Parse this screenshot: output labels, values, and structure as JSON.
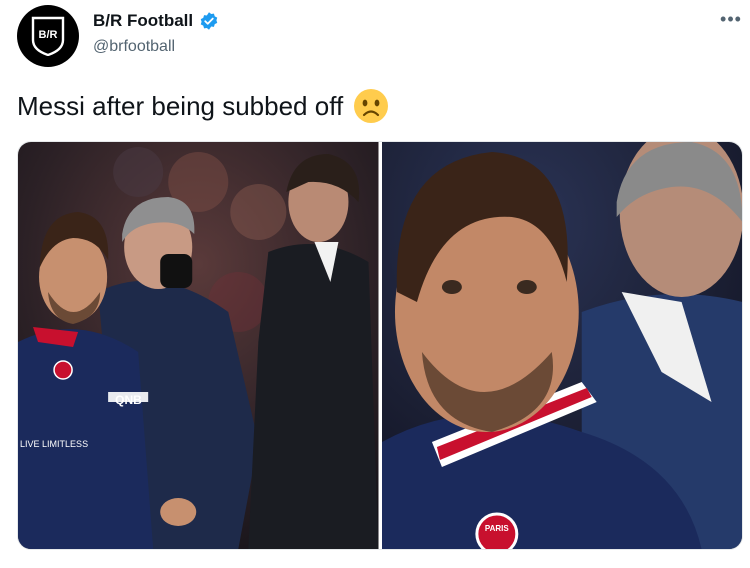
{
  "author": {
    "display_name": "B/R Football",
    "handle": "@brfootball",
    "avatar_text": "B/R",
    "verified": true
  },
  "tweet": {
    "text": "Messi after being subbed off",
    "emoji": "frowning-face"
  },
  "media": {
    "photos": [
      {
        "sponsor_text": "QNB",
        "sleeve_text": "LIVE LIMITLESS"
      },
      {
        "badge_text": "PARIS"
      }
    ]
  },
  "colors": {
    "verified_blue": "#1d9bf0",
    "psg_navy": "#1b2a5c",
    "psg_red": "#c8102e"
  }
}
